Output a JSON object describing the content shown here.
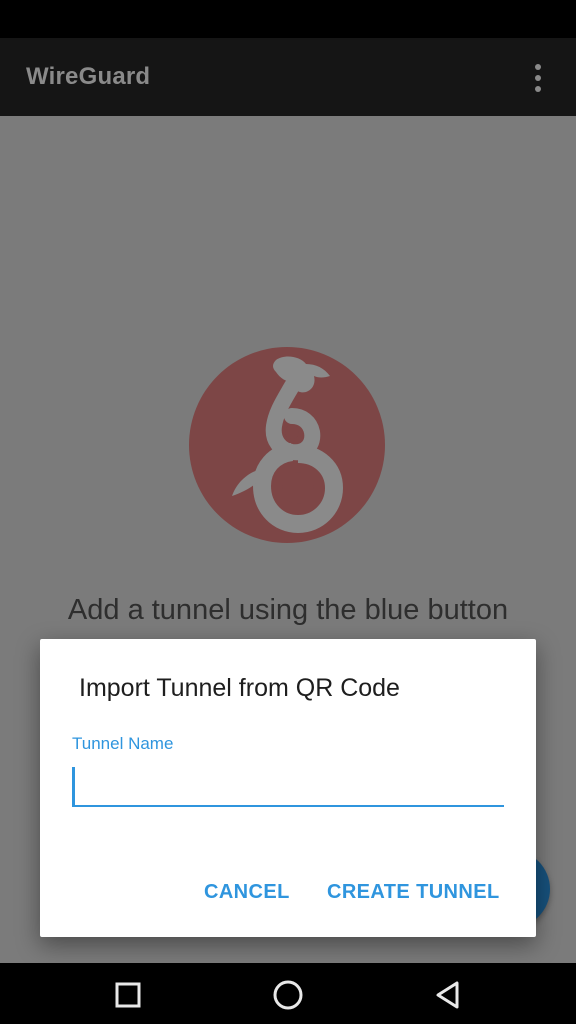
{
  "app_bar": {
    "title": "WireGuard",
    "overflow_icon": "more-vert-icon"
  },
  "main": {
    "logo_icon": "wireguard-dragon-logo",
    "empty_message": "Add a tunnel using the blue button",
    "fab_icon": "add-icon"
  },
  "dialog": {
    "title": "Import Tunnel from QR Code",
    "field_label": "Tunnel Name",
    "field_value": "",
    "cancel_label": "CANCEL",
    "create_label": "CREATE TUNNEL"
  },
  "nav_bar": {
    "recents_icon": "recents-square-icon",
    "home_icon": "home-circle-icon",
    "back_icon": "back-triangle-icon"
  },
  "colors": {
    "accent": "#2f95de",
    "scrim_background": "#7b7b7b",
    "app_bar": "#151515",
    "logo_red": "#8a2f2f",
    "fab": "#17517c"
  }
}
